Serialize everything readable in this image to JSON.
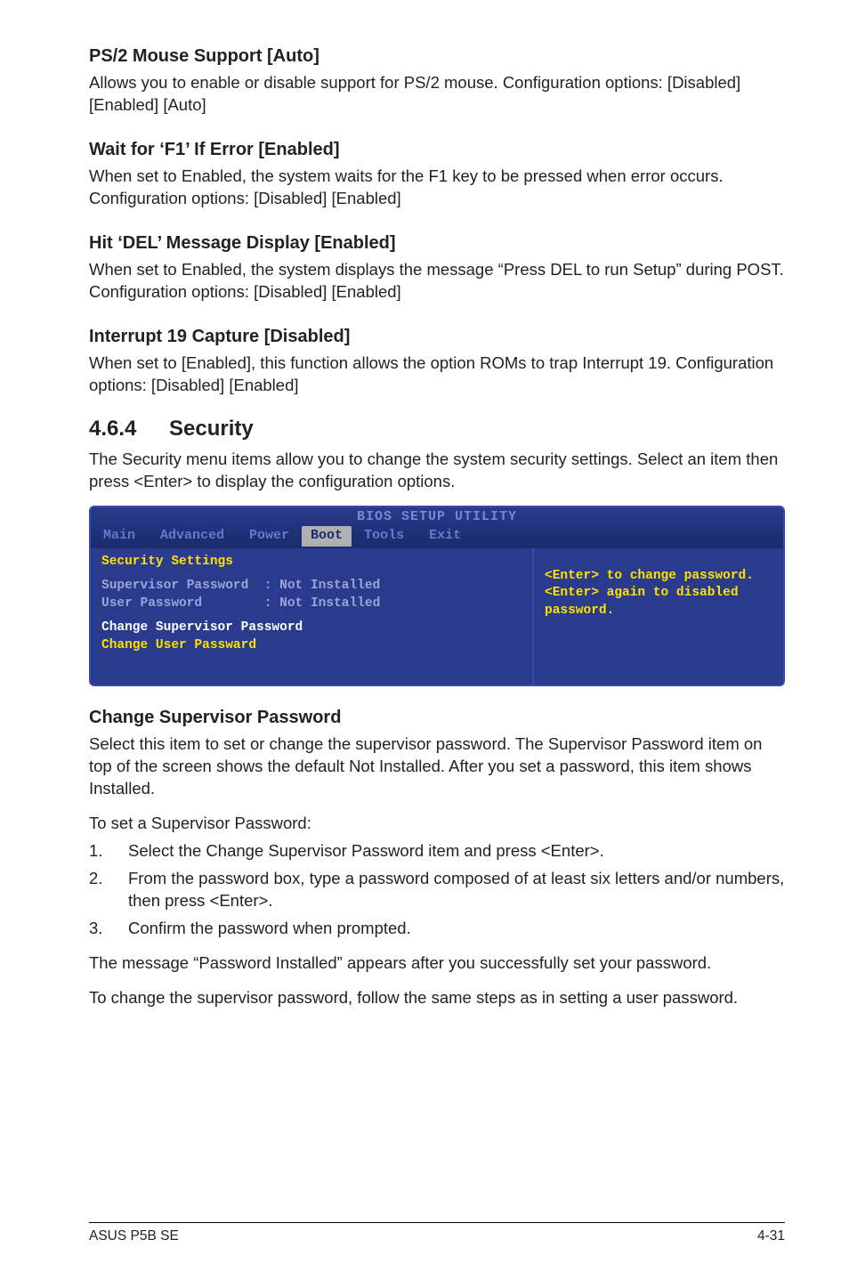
{
  "sections": {
    "ps2": {
      "heading": "PS/2 Mouse Support [Auto]",
      "body": "Allows you to enable or disable support for PS/2 mouse. Configuration options: [Disabled] [Enabled] [Auto]"
    },
    "f1": {
      "heading": "Wait for ‘F1’ If Error [Enabled]",
      "body": "When set to Enabled, the system waits for the F1 key to be pressed when error occurs. Configuration options: [Disabled] [Enabled]"
    },
    "del": {
      "heading": "Hit ‘DEL’ Message Display [Enabled]",
      "body": "When set to Enabled, the system displays the message “Press DEL to run Setup” during POST. Configuration options: [Disabled] [Enabled]"
    },
    "int19": {
      "heading": "Interrupt 19 Capture [Disabled]",
      "body": "When set to [Enabled], this function allows the option ROMs to trap Interrupt 19. Configuration options: [Disabled] [Enabled]"
    },
    "security": {
      "num": "4.6.4",
      "title": "Security",
      "body": "The Security menu items allow you to change the system security settings. Select an item then press <Enter> to display the configuration options."
    },
    "changepw": {
      "heading": "Change Supervisor Password",
      "body1": "Select this item to set or change the supervisor password. The Supervisor Password item on top of the screen shows the default Not Installed. After you set a password, this item shows Installed.",
      "body2": "To set a Supervisor Password:",
      "step1": "Select the Change Supervisor Password item and press <Enter>.",
      "step2": "From the password box, type a password composed of at least six letters and/or numbers, then press <Enter>.",
      "step3": "Confirm the password when prompted.",
      "body3": "The message “Password Installed” appears after you successfully set your password.",
      "body4": "To change the supervisor password, follow the same steps as in setting a user password."
    }
  },
  "bios": {
    "title": "BIOS SETUP UTILITY",
    "tabs": {
      "main": "Main",
      "advanced": "Advanced",
      "power": "Power",
      "boot": "Boot",
      "tools": "Tools",
      "exit": "Exit"
    },
    "left": {
      "heading": "Security Settings",
      "sup_label": "Supervisor Password",
      "sup_value": ": Not Installed",
      "user_label": "User Password",
      "user_value": ": Not Installed",
      "change_sup": "Change Supervisor Password",
      "change_user": "Change User Passward"
    },
    "right": {
      "help": "<Enter> to change password.\n<Enter> again to disabled password."
    }
  },
  "list_numbers": {
    "n1": "1.",
    "n2": "2.",
    "n3": "3."
  },
  "footer": {
    "left": "ASUS P5B SE",
    "right": "4-31"
  }
}
